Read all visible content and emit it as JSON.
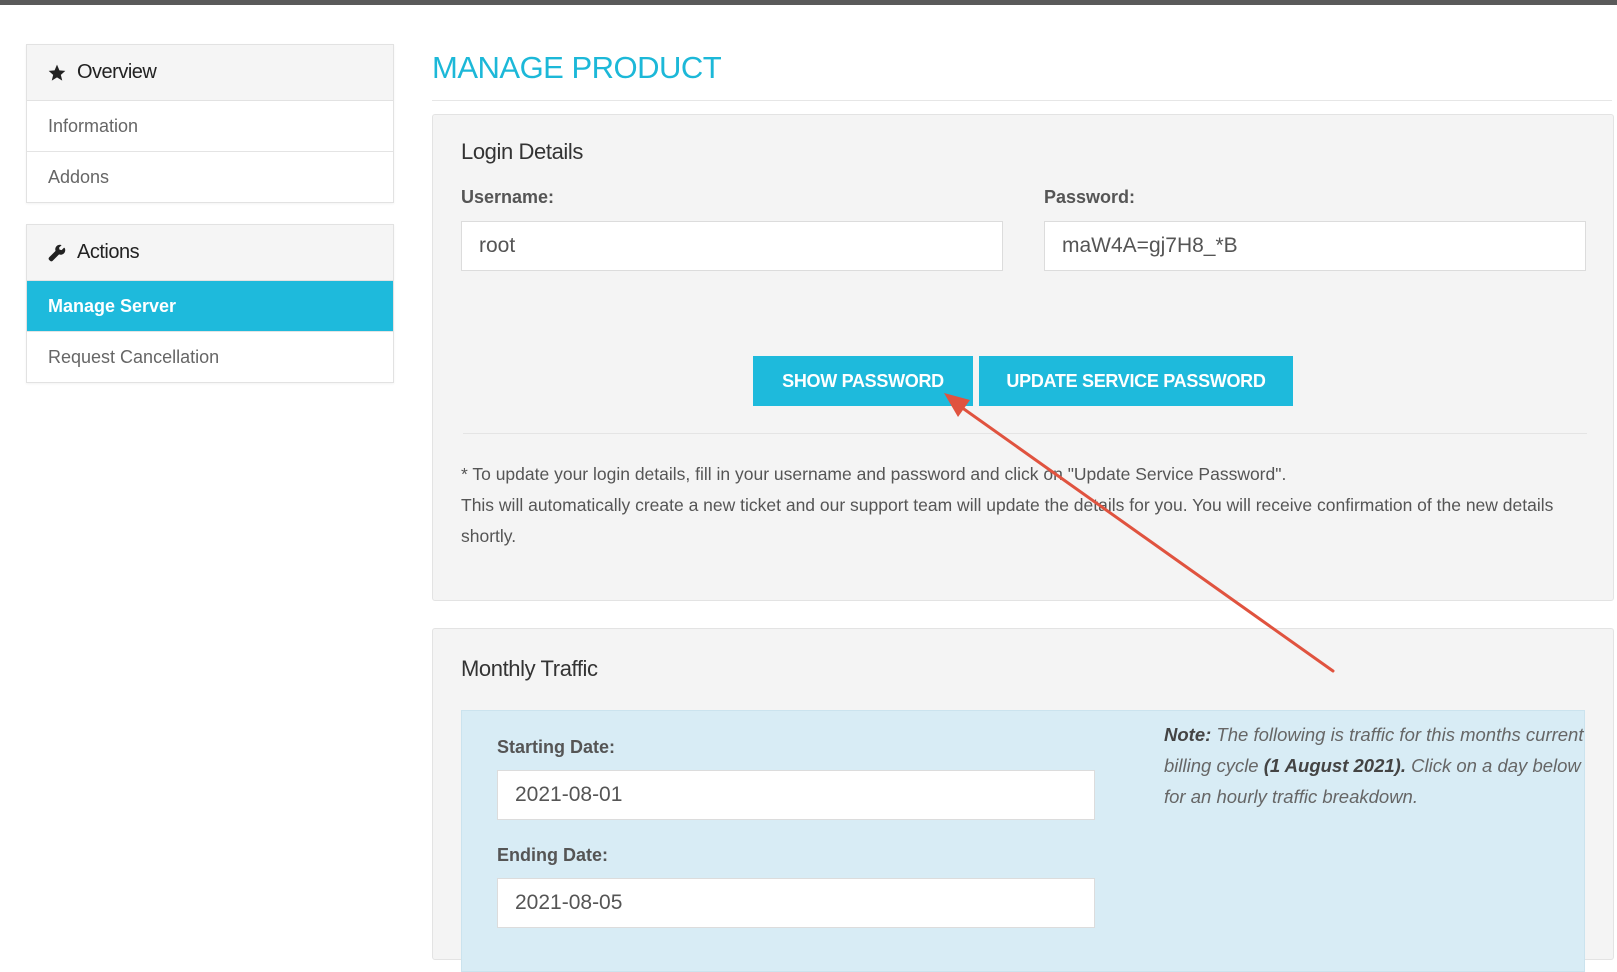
{
  "sidebar": {
    "overview": {
      "heading": "Overview",
      "icon": "star-icon",
      "items": [
        {
          "label": "Information",
          "active": false
        },
        {
          "label": "Addons",
          "active": false
        }
      ]
    },
    "actions": {
      "heading": "Actions",
      "icon": "wrench-icon",
      "items": [
        {
          "label": "Manage Server",
          "active": true
        },
        {
          "label": "Request Cancellation",
          "active": false
        }
      ]
    }
  },
  "main": {
    "title": "MANAGE PRODUCT",
    "login": {
      "heading": "Login Details",
      "username_label": "Username:",
      "username_value": "root",
      "password_label": "Password:",
      "password_value": "maW4A=gj7H8_*B",
      "show_password_button": "SHOW PASSWORD",
      "update_password_button": "UPDATE SERVICE PASSWORD",
      "note_line1": "* To update your login details, fill in your username and password and click on \"Update Service Password\".",
      "note_line2": "This will automatically create a new ticket and our support team will update the details for you. You will receive confirmation of the new details shortly."
    },
    "traffic": {
      "heading": "Monthly Traffic",
      "start_label": "Starting Date:",
      "start_value": "2021-08-01",
      "end_label": "Ending Date:",
      "end_value": "2021-08-05",
      "note_label": "Note:",
      "note_text_1": " The following is traffic for this months current billing cycle ",
      "note_cycle": "(1 August 2021).",
      "note_text_2": " Click on a day below for an hourly traffic breakdown."
    }
  },
  "colors": {
    "accent": "#1ebadc",
    "title": "#1cb8d8",
    "annotation_arrow": "#e0533f",
    "traffic_box": "#d8ecf5"
  }
}
